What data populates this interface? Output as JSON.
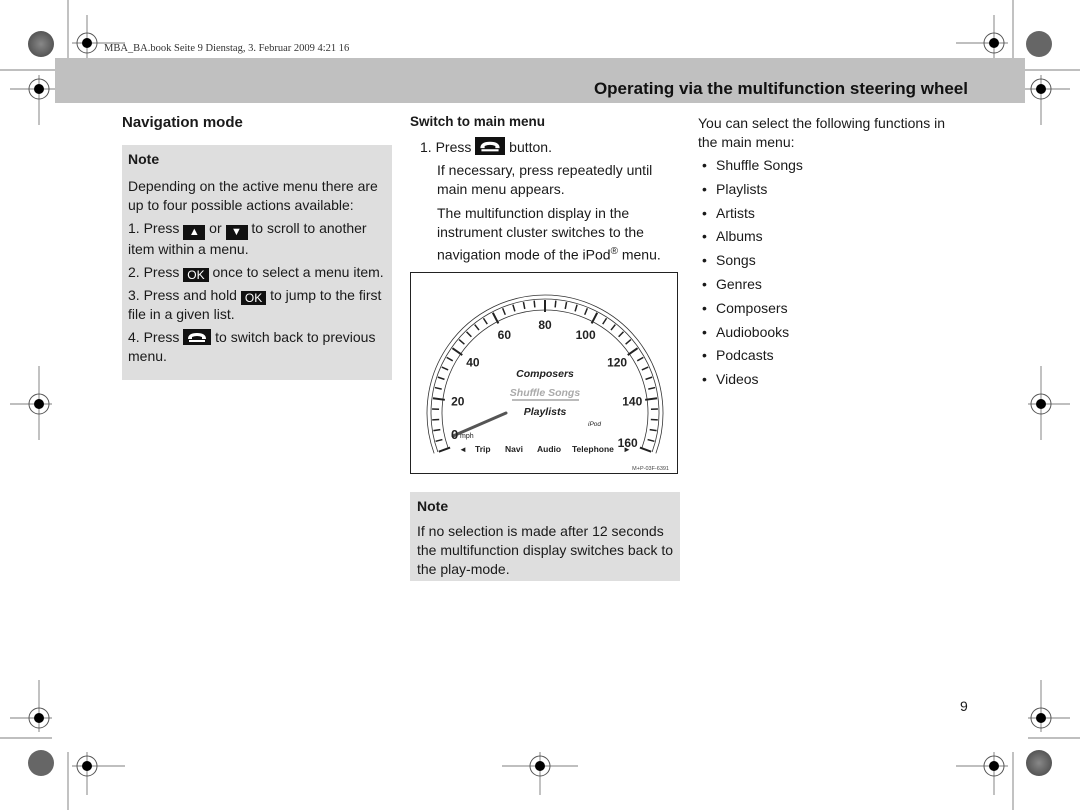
{
  "print_info": "MBA_BA.book  Seite 9  Dienstag, 3. Februar 2009  4:21 16",
  "header": {
    "title": "Operating via the multifunction steering wheel"
  },
  "left": {
    "heading": "Navigation mode",
    "note": {
      "title": "Note",
      "intro": "Depending on the active menu there are up to four possible actions available:",
      "steps": [
        {
          "num": "1.",
          "pre": "Press",
          "mid": "or",
          "post": "to scroll to another item within a menu."
        },
        {
          "num": "2.",
          "pre": "Press",
          "key": "OK",
          "post": "once to select a menu item."
        },
        {
          "num": "3.",
          "pre": "Press and hold",
          "key": "OK",
          "post": "to jump to the first file in a given list."
        },
        {
          "num": "4.",
          "pre": "Press",
          "post": "to switch back to previous menu."
        }
      ],
      "keys": {
        "up": "▲",
        "down": "▼"
      }
    }
  },
  "middle": {
    "heading": "Switch to main menu",
    "step_num": "1.",
    "step_pre": "Press",
    "step_post": "button.",
    "para1": "If necessary, press repeatedly until main menu appears.",
    "para2_a": "The multifunction display in the instrument cluster switches to the navigation mode of the iPod",
    "para2_reg": "®",
    "para2_b": " menu.",
    "figure": {
      "speed_labels": [
        "20",
        "40",
        "60",
        "80",
        "100",
        "120",
        "140",
        "160"
      ],
      "zero_label": "0",
      "unit": "mph",
      "menu_above": "Composers",
      "menu_selected": "Shuffle Songs",
      "menu_below": "Playlists",
      "source": "iPod",
      "tabs": [
        "Trip",
        "Navi",
        "Audio",
        "Telephone"
      ],
      "left_arrow": "◄",
      "right_arrow": "►",
      "figure_id": "M+P-03F-6391"
    },
    "note": {
      "title": "Note",
      "text": "If no selection is made after 12 seconds the multifunction display switches back to the play-mode."
    }
  },
  "right": {
    "intro": "You can select the following functions in the main menu:",
    "bullet": "•",
    "items": [
      "Shuffle Songs",
      "Playlists",
      "Artists",
      "Albums",
      "Songs",
      "Genres",
      "Composers",
      "Audiobooks",
      "Podcasts",
      "Videos"
    ]
  },
  "page_number": "9"
}
